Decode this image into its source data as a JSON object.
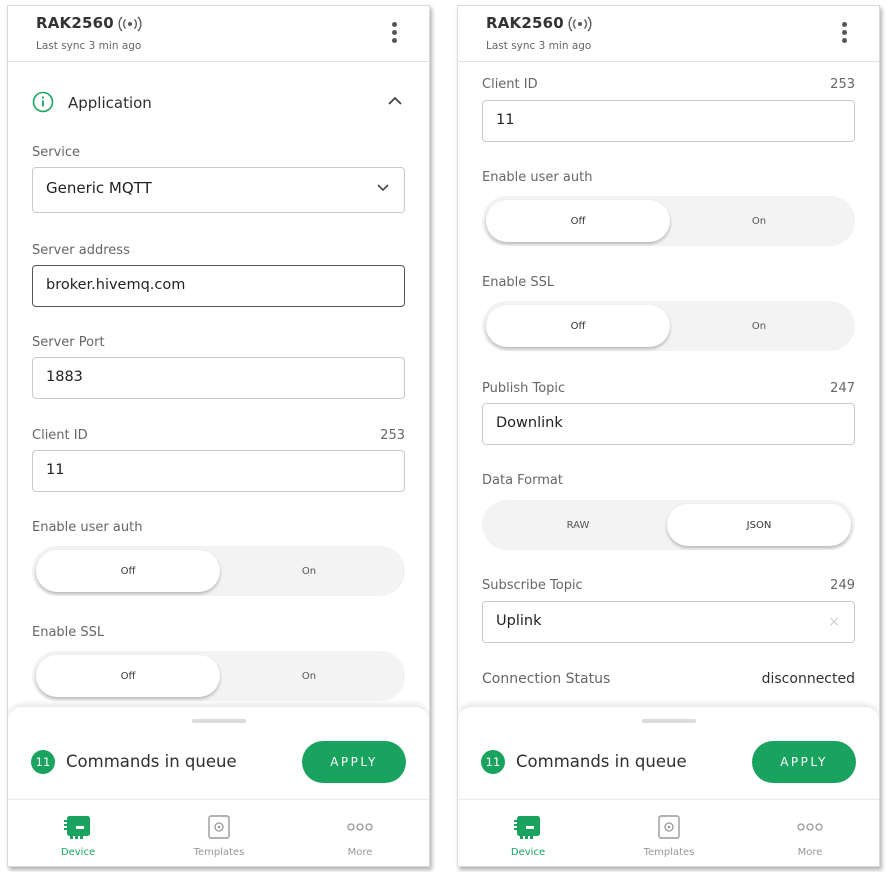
{
  "header": {
    "device_name": "RAK2560",
    "last_sync": "Last sync 3 min ago",
    "signal_icon": "signal-broadcast-icon",
    "menu_icon": "kebab-menu-icon"
  },
  "left": {
    "section": {
      "title": "Application",
      "icon": "info-icon",
      "toggle_icon": "chevron-up-icon"
    },
    "service": {
      "label": "Service",
      "value": "Generic MQTT"
    },
    "server_address": {
      "label": "Server address",
      "value": "broker.hivemq.com"
    },
    "server_port": {
      "label": "Server Port",
      "value": "1883"
    },
    "client_id": {
      "label": "Client ID",
      "count": "253",
      "value": "11"
    },
    "user_auth": {
      "label": "Enable user auth",
      "off": "Off",
      "on": "On",
      "selected": "Off"
    },
    "ssl": {
      "label": "Enable SSL",
      "off": "Off",
      "on": "On",
      "selected": "Off"
    }
  },
  "right": {
    "client_id": {
      "label": "Client ID",
      "count": "253",
      "value": "11"
    },
    "user_auth": {
      "label": "Enable user auth",
      "off": "Off",
      "on": "On",
      "selected": "Off"
    },
    "ssl": {
      "label": "Enable SSL",
      "off": "Off",
      "on": "On",
      "selected": "Off"
    },
    "publish_topic": {
      "label": "Publish Topic",
      "count": "247",
      "value": "Downlink"
    },
    "data_format": {
      "label": "Data Format",
      "raw": "RAW",
      "json": "JSON",
      "selected": "JSON"
    },
    "subscribe_topic": {
      "label": "Subscribe Topic",
      "count": "249",
      "value": "Uplink",
      "clear": "×"
    },
    "connection_status": {
      "label": "Connection Status",
      "value": "disconnected"
    }
  },
  "queue": {
    "count": "11",
    "text": "Commands in queue",
    "apply_label": "APPLY"
  },
  "tabs": [
    {
      "label": "Device",
      "icon": "device-board-icon",
      "active": true
    },
    {
      "label": "Templates",
      "icon": "templates-icon",
      "active": false
    },
    {
      "label": "More",
      "icon": "more-dots-icon",
      "active": false
    }
  ],
  "colors": {
    "accent": "#1aa35f",
    "text": "#2f2f2f",
    "muted": "#666666"
  }
}
